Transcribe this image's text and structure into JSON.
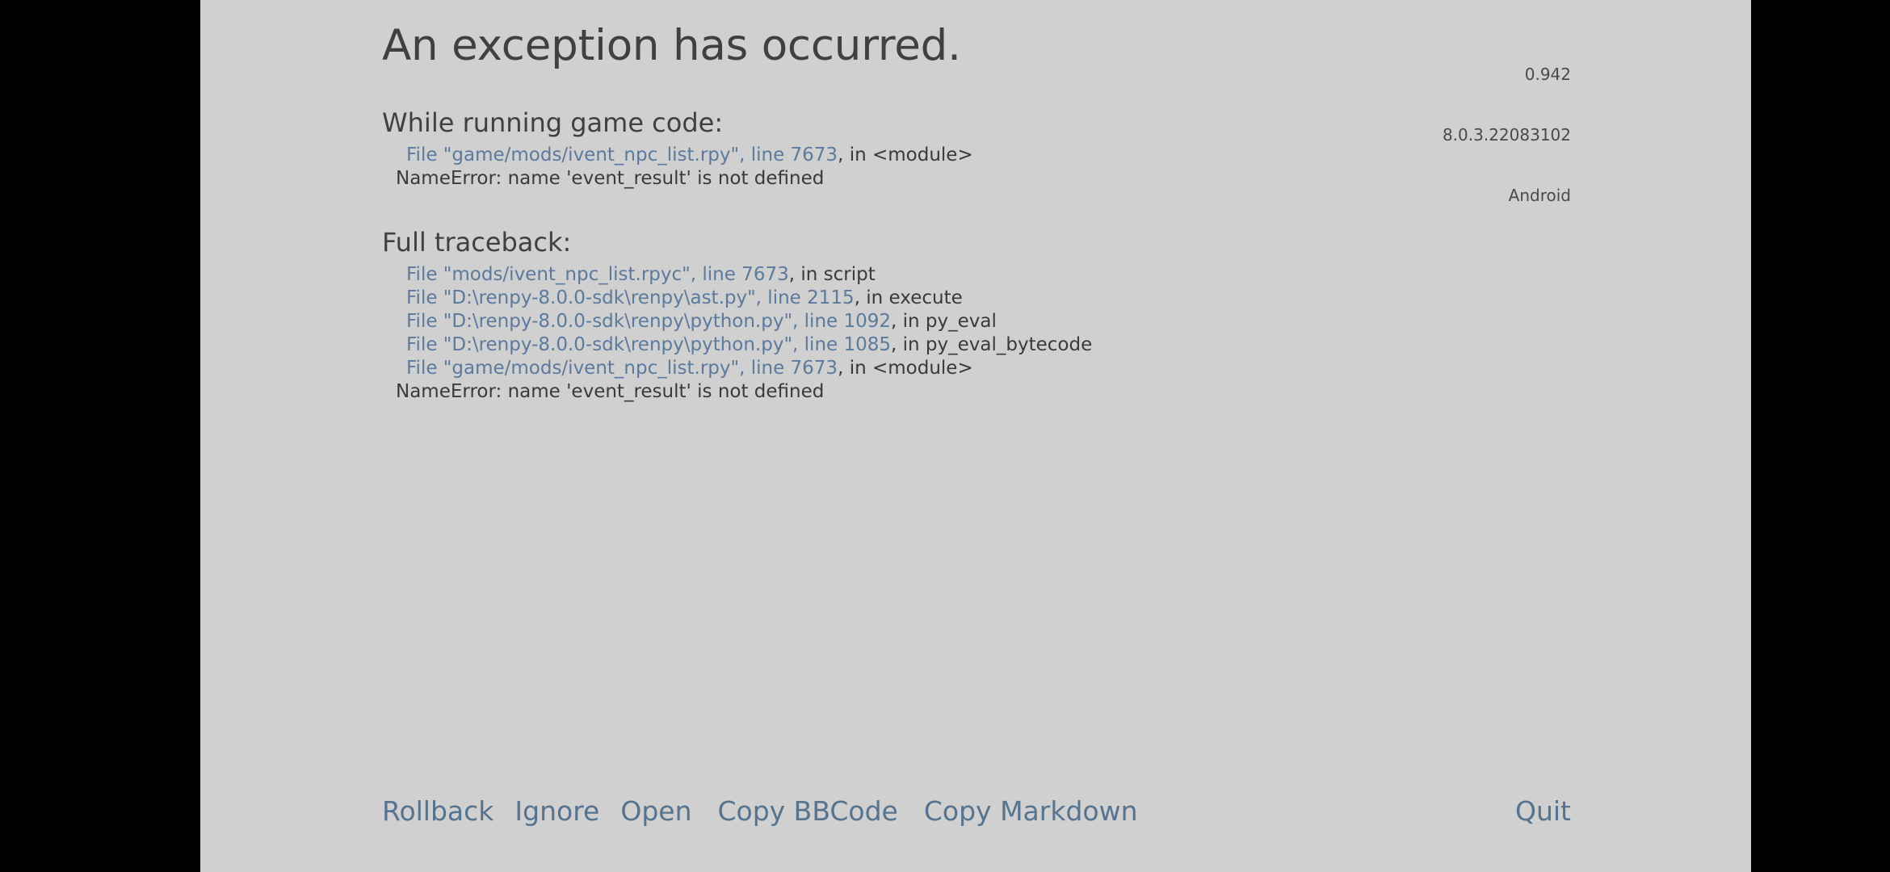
{
  "window": {
    "background_color": "#000000",
    "panel_color": "#d0d0d0",
    "link_color": "#5b7a9d",
    "text_color": "#3a3a3a",
    "heading_color": "#404040",
    "button_color": "#56738f"
  },
  "version": {
    "game_version": "0.942",
    "engine_version": "8.0.3.22083102",
    "platform": "Android"
  },
  "title": "An exception has occurred.",
  "sections": [
    {
      "heading": "While running game code:",
      "lines": [
        {
          "kind": "file",
          "link": "File \"game/mods/ivent_npc_list.rpy\", line 7673",
          "rest": ", in <module>"
        },
        {
          "kind": "error",
          "text": "NameError: name 'event_result' is not defined"
        }
      ]
    },
    {
      "heading": "Full traceback:",
      "lines": [
        {
          "kind": "file",
          "link": "File \"mods/ivent_npc_list.rpyc\", line 7673",
          "rest": ", in script"
        },
        {
          "kind": "file",
          "link": "File \"D:\\renpy-8.0.0-sdk\\renpy\\ast.py\", line 2115",
          "rest": ", in execute"
        },
        {
          "kind": "file",
          "link": "File \"D:\\renpy-8.0.0-sdk\\renpy\\python.py\", line 1092",
          "rest": ", in py_eval"
        },
        {
          "kind": "file",
          "link": "File \"D:\\renpy-8.0.0-sdk\\renpy\\python.py\", line 1085",
          "rest": ", in py_eval_bytecode"
        },
        {
          "kind": "file",
          "link": "File \"game/mods/ivent_npc_list.rpy\", line 7673",
          "rest": ", in <module>"
        },
        {
          "kind": "error",
          "text": "NameError: name 'event_result' is not defined"
        }
      ]
    }
  ],
  "buttons": {
    "left": [
      {
        "label": "Rollback"
      },
      {
        "label": "Ignore"
      },
      {
        "label": "Open"
      },
      {
        "label": "Copy BBCode"
      },
      {
        "label": "Copy Markdown"
      }
    ],
    "right": [
      {
        "label": "Quit"
      }
    ]
  }
}
